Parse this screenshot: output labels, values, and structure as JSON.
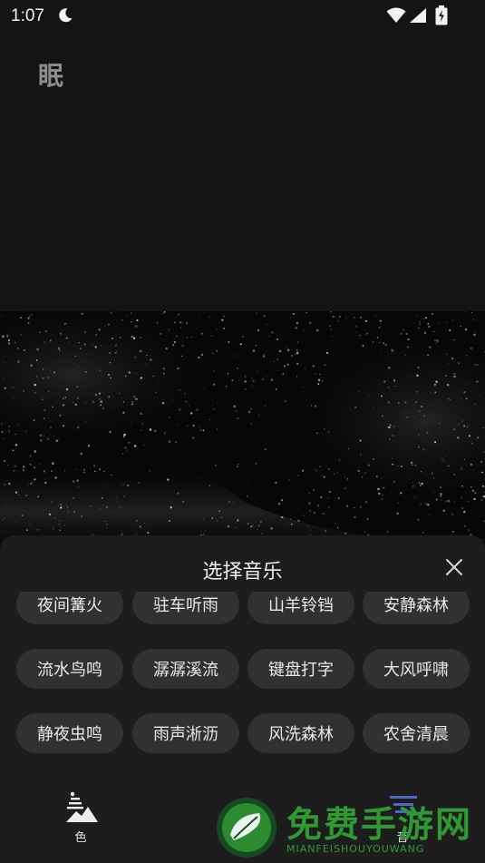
{
  "status_bar": {
    "time": "1:07",
    "icons": [
      "moon-icon",
      "wifi-icon",
      "signal-icon",
      "battery-charging-icon"
    ]
  },
  "app": {
    "title": "眠"
  },
  "sheet": {
    "title": "选择音乐",
    "close_icon": "close-icon",
    "rows": [
      [
        "夜间篝火",
        "驻车听雨",
        "山羊铃铛",
        "安静森林"
      ],
      [
        "流水鸟鸣",
        "潺潺溪流",
        "键盘打字",
        "大风呼啸"
      ],
      [
        "静夜虫鸣",
        "雨声淅沥",
        "风洗森林",
        "农舍清晨"
      ]
    ]
  },
  "tabs": [
    {
      "label": "色",
      "icon": "landscape-icon"
    },
    {
      "label": "音",
      "icon": "music-list-icon"
    }
  ],
  "watermark": {
    "title": "免费手游网",
    "subtitle": "MIANFEISHOUYOUWANG"
  },
  "colors": {
    "background": "#141414",
    "sheet": "#1d1d1d",
    "chip": "#313131",
    "watermark_green": "#2f9a34"
  }
}
